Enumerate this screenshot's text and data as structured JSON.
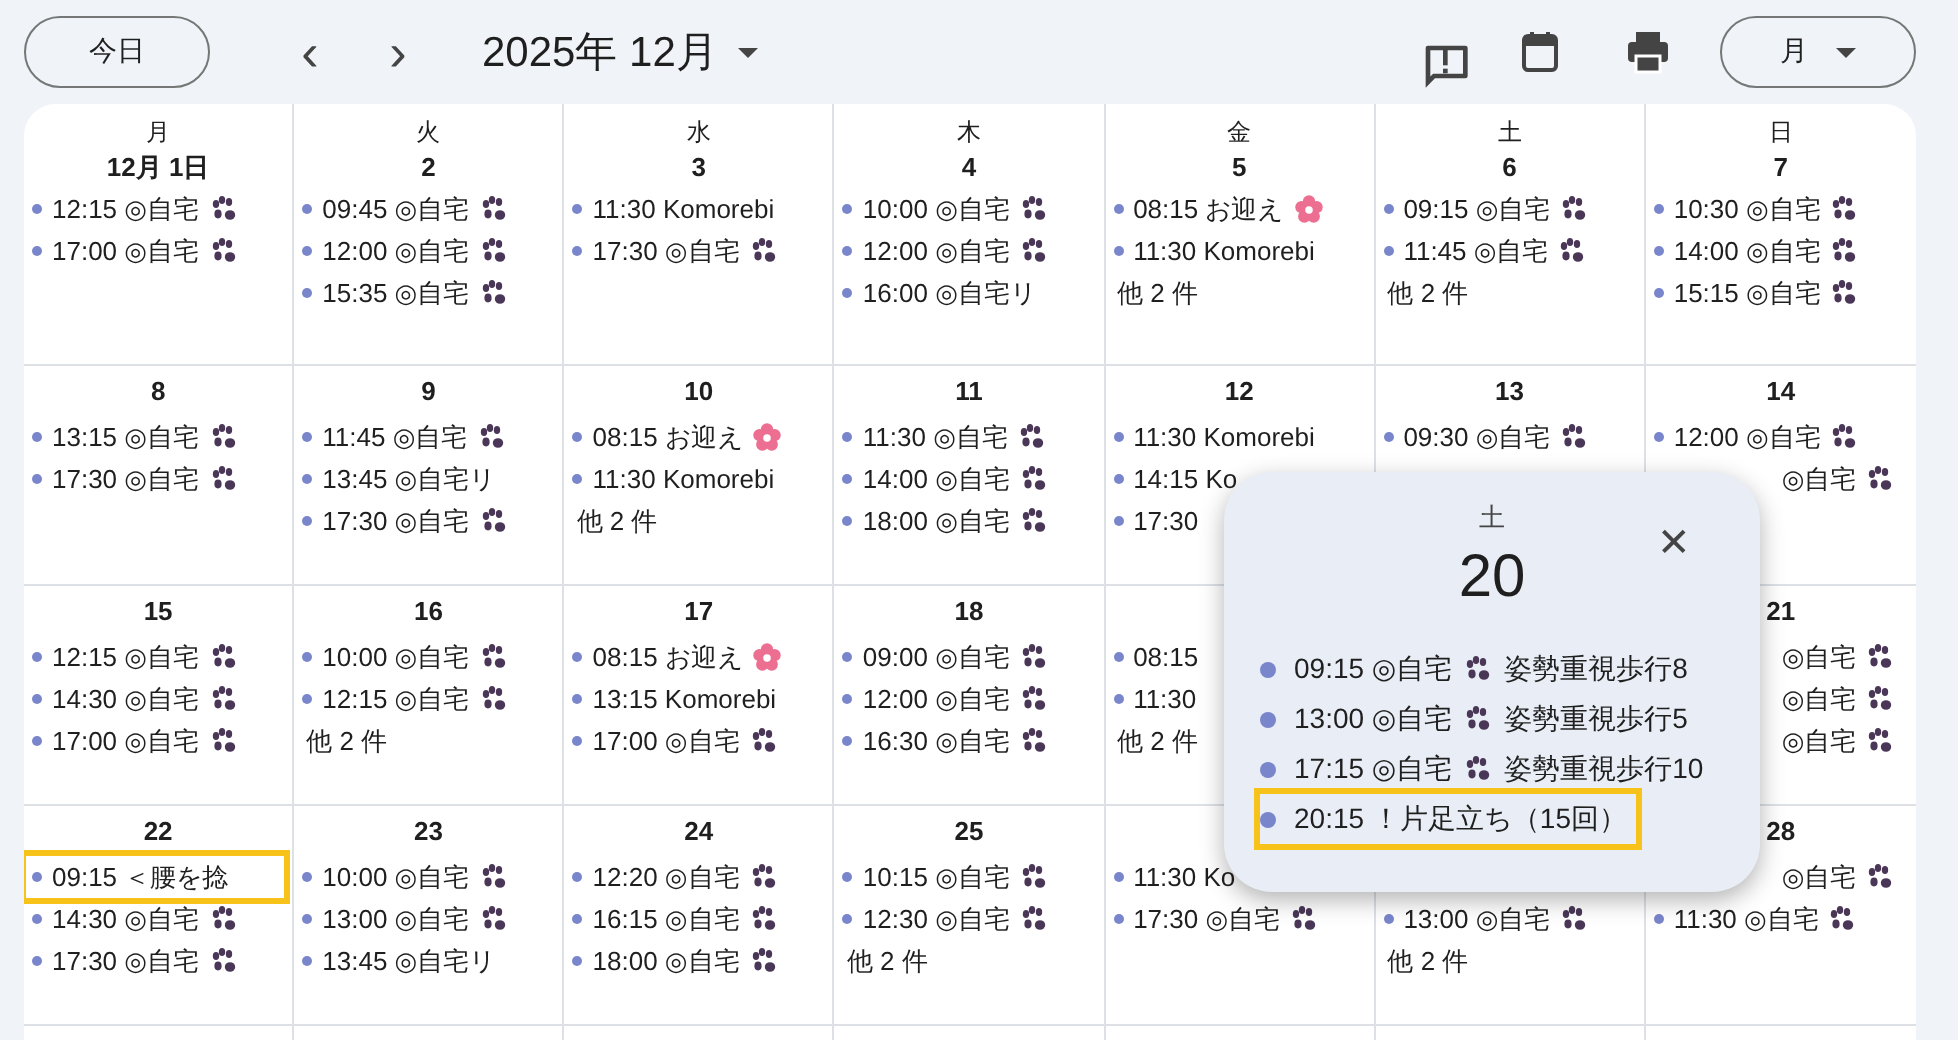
{
  "toolbar": {
    "today": "今日",
    "prev": "‹",
    "next": "›",
    "title": "2025年 12月",
    "view": "月"
  },
  "weekdays": [
    "月",
    "火",
    "水",
    "木",
    "金",
    "土",
    "日"
  ],
  "weeks": [
    {
      "cells": [
        {
          "date": "12月 1日",
          "events": [
            {
              "time": "12:15",
              "title": "◎自宅",
              "kind": "paw"
            },
            {
              "time": "17:00",
              "title": "◎自宅",
              "kind": "paw"
            }
          ]
        },
        {
          "date": "2",
          "events": [
            {
              "time": "09:45",
              "title": "◎自宅",
              "kind": "paw"
            },
            {
              "time": "12:00",
              "title": "◎自宅",
              "kind": "paw"
            },
            {
              "time": "15:35",
              "title": "◎自宅",
              "kind": "paw"
            }
          ]
        },
        {
          "date": "3",
          "events": [
            {
              "time": "11:30",
              "title": "Komorebi"
            },
            {
              "time": "17:30",
              "title": "◎自宅",
              "kind": "paw"
            }
          ]
        },
        {
          "date": "4",
          "events": [
            {
              "time": "10:00",
              "title": "◎自宅",
              "kind": "paw"
            },
            {
              "time": "12:00",
              "title": "◎自宅",
              "kind": "paw"
            },
            {
              "time": "16:00",
              "title": "◎自宅リ"
            }
          ]
        },
        {
          "date": "5",
          "events": [
            {
              "time": "08:15",
              "title": "お迎え",
              "kind": "flower"
            },
            {
              "time": "11:30",
              "title": "Komorebi"
            }
          ],
          "more": "他 2 件"
        },
        {
          "date": "6",
          "events": [
            {
              "time": "09:15",
              "title": "◎自宅",
              "kind": "paw"
            },
            {
              "time": "11:45",
              "title": "◎自宅",
              "kind": "paw"
            }
          ],
          "more": "他 2 件"
        },
        {
          "date": "7",
          "events": [
            {
              "time": "10:30",
              "title": "◎自宅",
              "kind": "paw"
            },
            {
              "time": "14:00",
              "title": "◎自宅",
              "kind": "paw"
            },
            {
              "time": "15:15",
              "title": "◎自宅",
              "kind": "paw"
            }
          ]
        }
      ]
    },
    {
      "cells": [
        {
          "date": "8",
          "events": [
            {
              "time": "13:15",
              "title": "◎自宅",
              "kind": "paw"
            },
            {
              "time": "17:30",
              "title": "◎自宅",
              "kind": "paw"
            }
          ]
        },
        {
          "date": "9",
          "events": [
            {
              "time": "11:45",
              "title": "◎自宅",
              "kind": "paw"
            },
            {
              "time": "13:45",
              "title": "◎自宅リ"
            },
            {
              "time": "17:30",
              "title": "◎自宅",
              "kind": "paw"
            }
          ]
        },
        {
          "date": "10",
          "events": [
            {
              "time": "08:15",
              "title": "お迎え",
              "kind": "flower"
            },
            {
              "time": "11:30",
              "title": "Komorebi"
            }
          ],
          "more": "他 2 件"
        },
        {
          "date": "11",
          "events": [
            {
              "time": "11:30",
              "title": "◎自宅",
              "kind": "paw"
            },
            {
              "time": "14:00",
              "title": "◎自宅",
              "kind": "paw"
            },
            {
              "time": "18:00",
              "title": "◎自宅",
              "kind": "paw"
            }
          ]
        },
        {
          "date": "12",
          "events": [
            {
              "time": "11:30",
              "title": "Komorebi"
            },
            {
              "time": "14:15",
              "title": "Ko"
            },
            {
              "time": "17:30"
            }
          ]
        },
        {
          "date": "13",
          "events": [
            {
              "time": "09:30",
              "title": "◎自宅",
              "kind": "paw"
            }
          ]
        },
        {
          "date": "14",
          "events": [
            {
              "time": "12:00",
              "title": "◎自宅",
              "kind": "paw"
            },
            {
              "title": "◎自宅",
              "kind": "paw"
            }
          ]
        }
      ]
    },
    {
      "cells": [
        {
          "date": "15",
          "events": [
            {
              "time": "12:15",
              "title": "◎自宅",
              "kind": "paw"
            },
            {
              "time": "14:30",
              "title": "◎自宅",
              "kind": "paw"
            },
            {
              "time": "17:00",
              "title": "◎自宅",
              "kind": "paw"
            }
          ]
        },
        {
          "date": "16",
          "events": [
            {
              "time": "10:00",
              "title": "◎自宅",
              "kind": "paw"
            },
            {
              "time": "12:15",
              "title": "◎自宅",
              "kind": "paw"
            }
          ],
          "more": "他 2 件"
        },
        {
          "date": "17",
          "events": [
            {
              "time": "08:15",
              "title": "お迎え",
              "kind": "flower"
            },
            {
              "time": "13:15",
              "title": "Komorebi"
            },
            {
              "time": "17:00",
              "title": "◎自宅",
              "kind": "paw"
            }
          ]
        },
        {
          "date": "18",
          "events": [
            {
              "time": "09:00",
              "title": "◎自宅",
              "kind": "paw"
            },
            {
              "time": "12:00",
              "title": "◎自宅",
              "kind": "paw"
            },
            {
              "time": "16:30",
              "title": "◎自宅",
              "kind": "paw"
            }
          ]
        },
        {
          "events": [
            {
              "time": "08:15"
            },
            {
              "time": "11:30"
            }
          ],
          "more": "他 2 件"
        },
        {},
        {
          "date": "21",
          "events": [
            {
              "title": "◎自宅",
              "kind": "paw"
            },
            {
              "title": "◎自宅",
              "kind": "paw"
            },
            {
              "title": "◎自宅",
              "kind": "paw"
            }
          ]
        }
      ]
    },
    {
      "cells": [
        {
          "date": "22",
          "events": [
            {
              "time": "09:15",
              "title": "＜腰を捻",
              "highlighted": true
            },
            {
              "time": "14:30",
              "title": "◎自宅",
              "kind": "paw",
              "highlighted": false
            },
            {
              "time": "17:30",
              "title": "◎自宅",
              "kind": "paw",
              "highlighted": false
            }
          ]
        },
        {
          "date": "23",
          "events": [
            {
              "time": "10:00",
              "title": "◎自宅",
              "kind": "paw"
            },
            {
              "time": "13:00",
              "title": "◎自宅",
              "kind": "paw"
            },
            {
              "time": "13:45",
              "title": "◎自宅リ"
            }
          ]
        },
        {
          "date": "24",
          "events": [
            {
              "time": "12:20",
              "title": "◎自宅",
              "kind": "paw"
            },
            {
              "time": "16:15",
              "title": "◎自宅",
              "kind": "paw"
            },
            {
              "time": "18:00",
              "title": "◎自宅",
              "kind": "paw"
            }
          ]
        },
        {
          "date": "25",
          "events": [
            {
              "time": "10:15",
              "title": "◎自宅",
              "kind": "paw"
            },
            {
              "time": "12:30",
              "title": "◎自宅",
              "kind": "paw"
            }
          ],
          "more": "他 2 件"
        },
        {
          "events": [
            {
              "time": "11:30",
              "title": "Ko"
            },
            {
              "time": "17:30",
              "title": "◎自宅",
              "kind": "paw"
            }
          ]
        },
        {
          "events": [
            {
              "kind": "covered"
            },
            {
              "time": "13:00",
              "title": "◎自宅",
              "kind": "paw"
            }
          ],
          "more": "他 2 件"
        },
        {
          "date": "28",
          "events": [
            {
              "title": "◎自宅",
              "kind": "paw"
            },
            {
              "time": "11:30",
              "title": "◎自宅",
              "kind": "paw"
            }
          ]
        }
      ]
    },
    {
      "cells": [
        {},
        {},
        {},
        {},
        {},
        {},
        {}
      ]
    }
  ],
  "popup": {
    "weekday": "土",
    "date": "20",
    "close": "✕",
    "events": [
      {
        "time": "09:15",
        "title": "◎自宅",
        "kind": "paw",
        "after": "姿勢重視歩行8",
        "highlighted": false
      },
      {
        "time": "13:00",
        "title": "◎自宅",
        "kind": "paw",
        "after": "姿勢重視歩行5",
        "highlighted": false
      },
      {
        "time": "17:15",
        "title": "◎自宅",
        "kind": "paw",
        "after": "姿勢重視歩行10",
        "highlighted": false
      },
      {
        "time": "20:15",
        "title": "！片足立ち（15回）",
        "highlighted": true
      }
    ]
  }
}
